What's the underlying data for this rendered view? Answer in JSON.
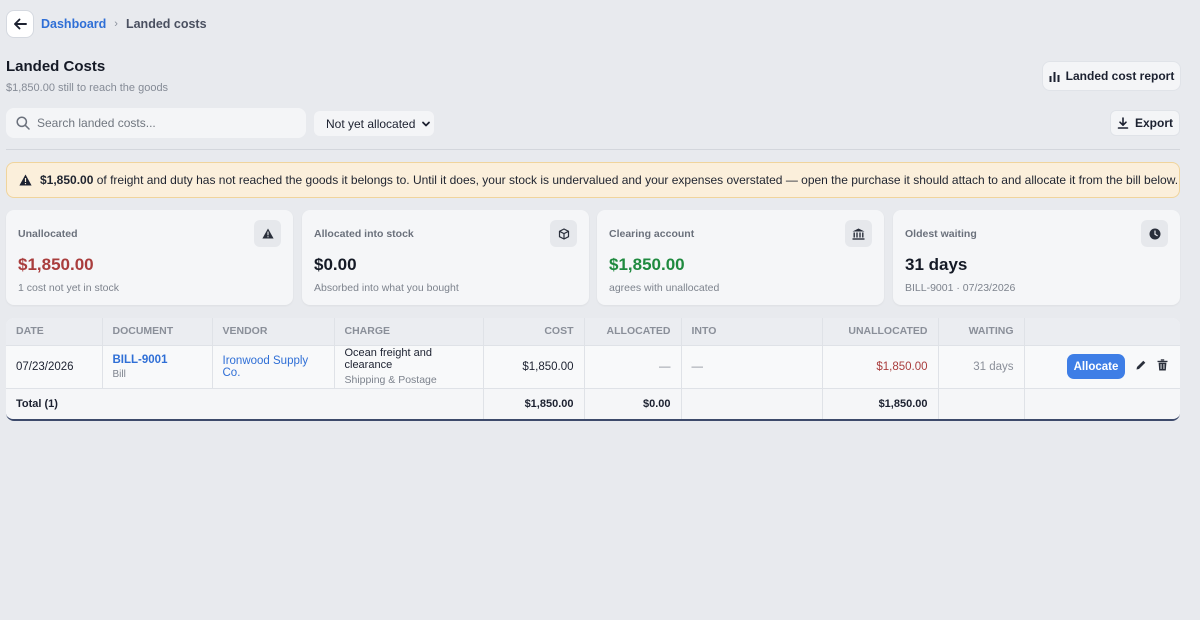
{
  "breadcrumb": {
    "root": "Dashboard",
    "current": "Landed costs"
  },
  "header": {
    "title": "Landed Costs",
    "subtitle": "$1,850.00 still to reach the goods",
    "report_button": "Landed cost report"
  },
  "toolbar": {
    "search_placeholder": "Search landed costs...",
    "filter_value": "Not yet allocated",
    "export_button": "Export"
  },
  "alert": {
    "amount": "$1,850.00",
    "message": " of freight and duty has not reached the goods it belongs to. Until it does, your stock is undervalued and your expenses overstated — open the purchase it should attach to and allocate it from the bill below."
  },
  "cards": [
    {
      "label": "Unallocated",
      "value": "$1,850.00",
      "note": "1 cost not yet in stock",
      "icon": "warning-icon",
      "color": "#a93d3d"
    },
    {
      "label": "Allocated into stock",
      "value": "$0.00",
      "note": "Absorbed into what you bought",
      "icon": "box-icon",
      "color": "#151a26"
    },
    {
      "label": "Clearing account",
      "value": "$1,850.00",
      "note": "agrees with unallocated",
      "icon": "bank-icon",
      "color": "#1f8a3f"
    },
    {
      "label": "Oldest waiting",
      "value": "31 days",
      "note": "BILL-9001 · 07/23/2026",
      "icon": "clock-icon",
      "color": "#151a26"
    }
  ],
  "table": {
    "columns": [
      "Date",
      "Document",
      "Vendor",
      "Charge",
      "Cost",
      "Allocated",
      "Into",
      "Unallocated",
      "Waiting",
      ""
    ],
    "rows": [
      {
        "date": "07/23/2026",
        "document": "BILL-9001",
        "document_type": "Bill",
        "vendor": "Ironwood Supply Co.",
        "charge": "Ocean freight and clearance",
        "charge_account": "Shipping & Postage",
        "cost": "$1,850.00",
        "allocated": "—",
        "into": "—",
        "unallocated": "$1,850.00",
        "waiting": "31 days",
        "action": "Allocate"
      }
    ],
    "total": {
      "label": "Total (1)",
      "cost": "$1,850.00",
      "allocated": "$0.00",
      "unallocated": "$1,850.00"
    }
  }
}
